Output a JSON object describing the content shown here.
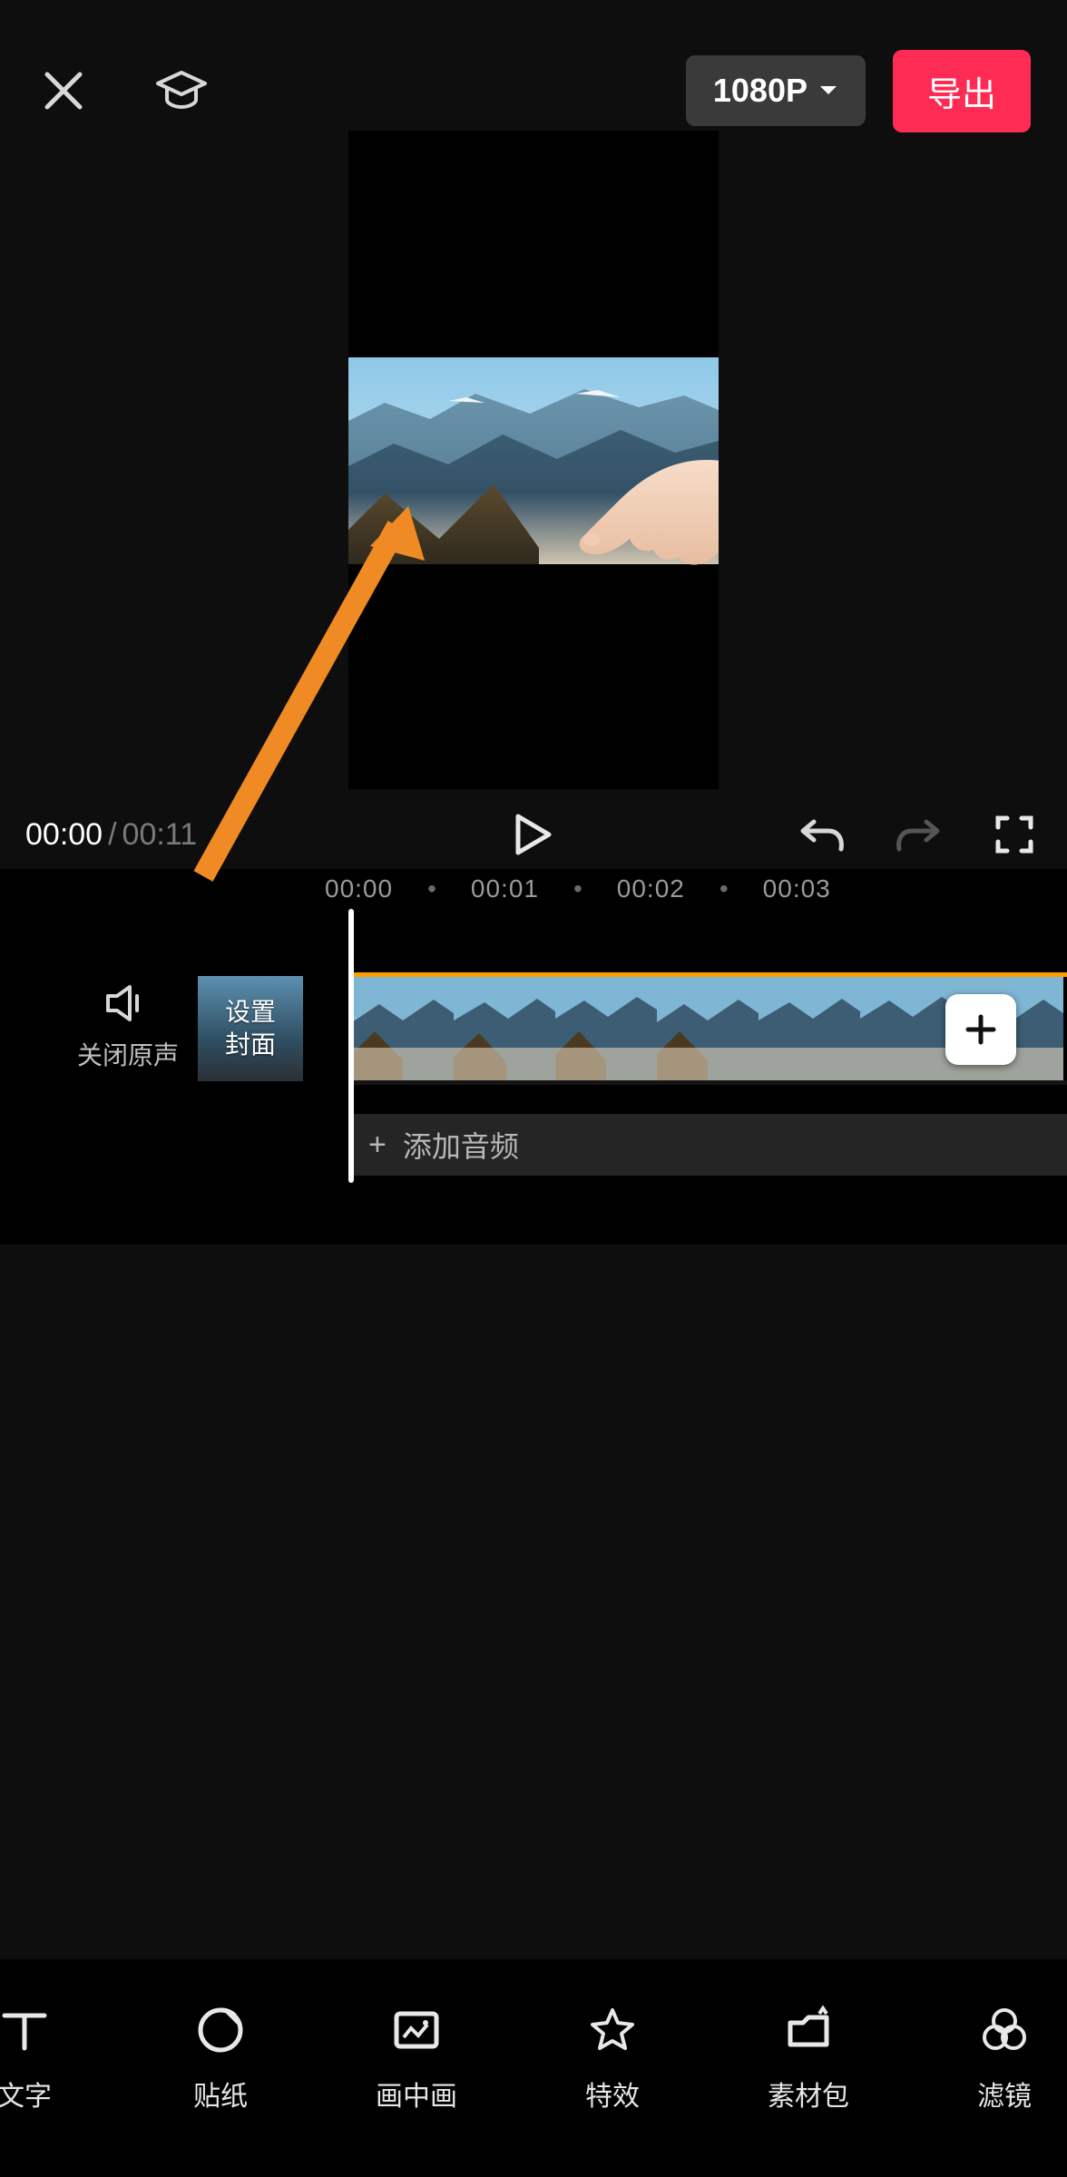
{
  "colors": {
    "accent": "#FE2C55",
    "clip_border": "#ff9e00",
    "arrow": "#F08A24",
    "bg": "#0e0e0e"
  },
  "topbar": {
    "close_icon": "close-icon",
    "academy_icon": "graduation-cap-icon",
    "resolution_label": "1080P",
    "export_label": "导出"
  },
  "preview": {
    "hand_gesture": "pointing-hand"
  },
  "controls": {
    "current_time": "00:00",
    "total_time": "00:11",
    "play_icon": "play-icon",
    "undo_icon": "undo-icon",
    "redo_icon": "redo-icon",
    "fullscreen_icon": "fullscreen-icon"
  },
  "ruler": {
    "ticks": [
      "00:00",
      "00:01",
      "00:02",
      "00:03"
    ]
  },
  "timeline": {
    "mute_label": "关闭原声",
    "cover_line1": "设置",
    "cover_line2": "封面",
    "add_clip": "+",
    "playhead_time": "00:00",
    "audio_add_label": "添加音频",
    "frames": [
      "mountain",
      "mountain",
      "mountain",
      "mountain"
    ]
  },
  "toolbar": {
    "items": [
      {
        "icon": "text-icon",
        "label": "文字"
      },
      {
        "icon": "sticker-icon",
        "label": "贴纸"
      },
      {
        "icon": "pip-icon",
        "label": "画中画"
      },
      {
        "icon": "effects-icon",
        "label": "特效"
      },
      {
        "icon": "material-pack-icon",
        "label": "素材包"
      },
      {
        "icon": "filter-icon",
        "label": "滤镜"
      }
    ]
  },
  "annotation": {
    "type": "arrow",
    "target": "preview-canvas"
  }
}
